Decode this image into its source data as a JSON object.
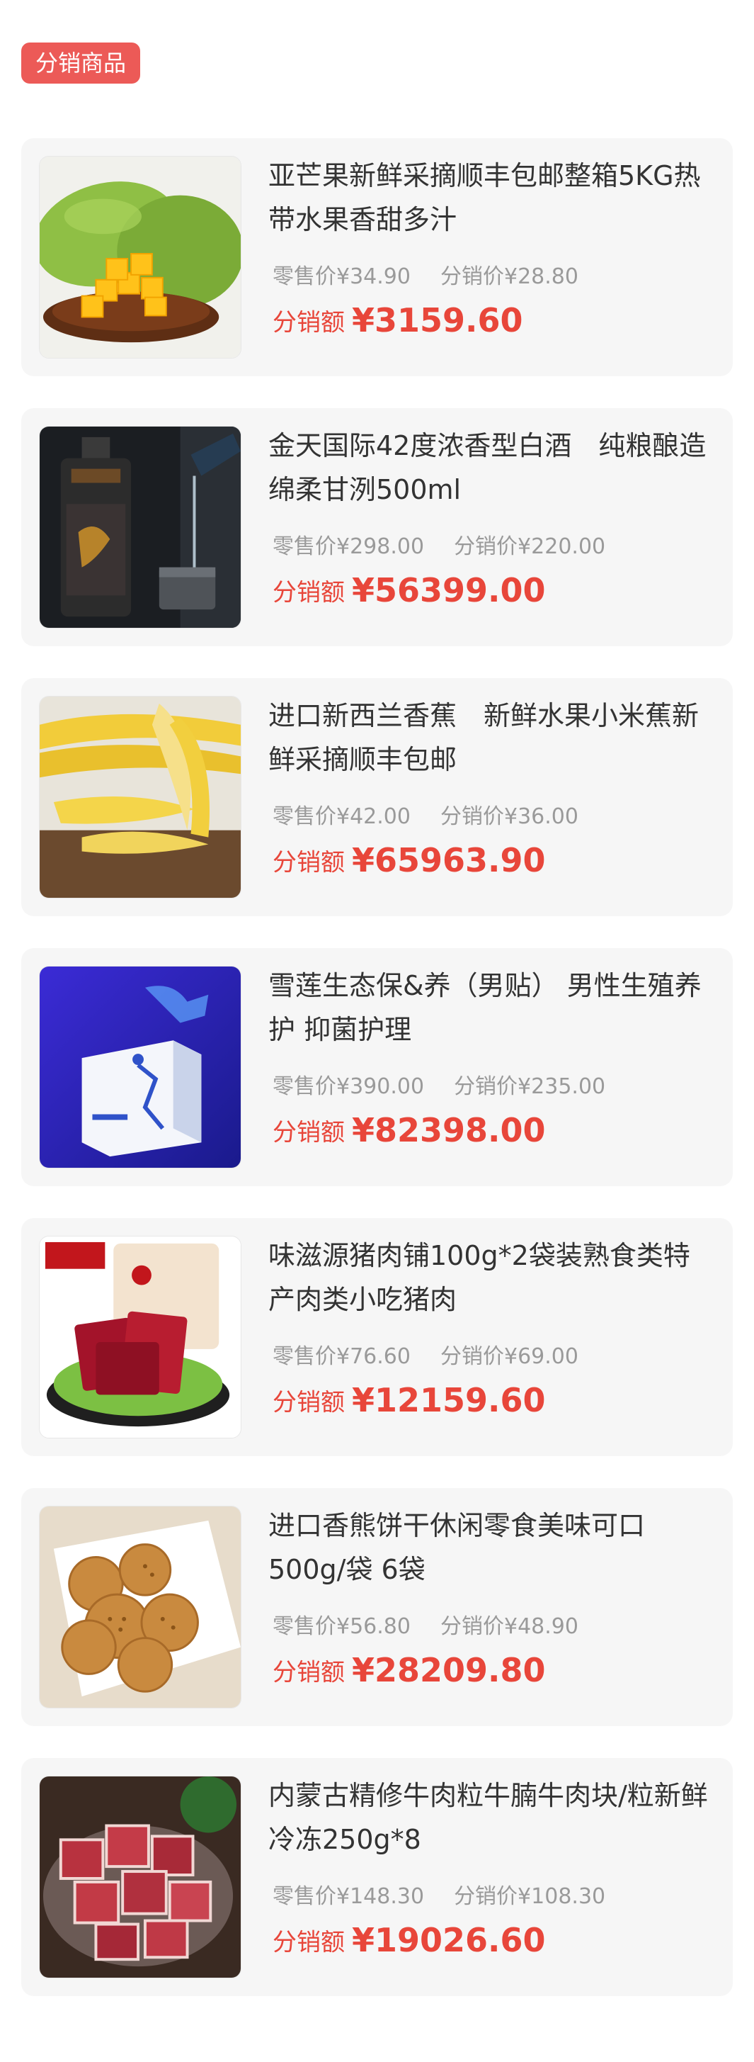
{
  "header": {
    "tag_label": "分销商品"
  },
  "labels": {
    "total_label": "分销额"
  },
  "colors": {
    "accent": "#e8463a",
    "tag_bg": "#ec5a57",
    "card_bg": "#f6f6f6"
  },
  "products": [
    {
      "title": "亚芒果新鲜采摘顺丰包邮整箱5KG热带水果香甜多汁",
      "retail": "零售价¥34.90",
      "distribution": "分销价¥28.80",
      "total": "¥3159.60",
      "image": "mango-image"
    },
    {
      "title": "金天国际42度浓香型白酒　纯粮酿造 绵柔甘洌500ml",
      "retail": "零售价¥298.00",
      "distribution": "分销价¥220.00",
      "total": "¥56399.00",
      "image": "liquor-image"
    },
    {
      "title": "进口新西兰香蕉　新鲜水果小米蕉新鲜采摘顺丰包邮",
      "retail": "零售价¥42.00",
      "distribution": "分销价¥36.00",
      "total": "¥65963.90",
      "image": "banana-image"
    },
    {
      "title": "雪莲生态保&养（男贴） 男性生殖养护 抑菌护理",
      "retail": "零售价¥390.00",
      "distribution": "分销价¥235.00",
      "total": "¥82398.00",
      "image": "health-box-image"
    },
    {
      "title": "味滋源猪肉铺100g*2袋装熟食类特产肉类小吃猪肉",
      "retail": "零售价¥76.60",
      "distribution": "分销价¥69.00",
      "total": "¥12159.60",
      "image": "pork-jerky-image"
    },
    {
      "title": "进口香熊饼干休闲零食美味可口500g/袋 6袋",
      "retail": "零售价¥56.80",
      "distribution": "分销价¥48.90",
      "total": "¥28209.80",
      "image": "biscuit-image"
    },
    {
      "title": "内蒙古精修牛肉粒牛腩牛肉块/粒新鲜冷冻250g*8",
      "retail": "零售价¥148.30",
      "distribution": "分销价¥108.30",
      "total": "¥19026.60",
      "image": "beef-cubes-image"
    }
  ]
}
